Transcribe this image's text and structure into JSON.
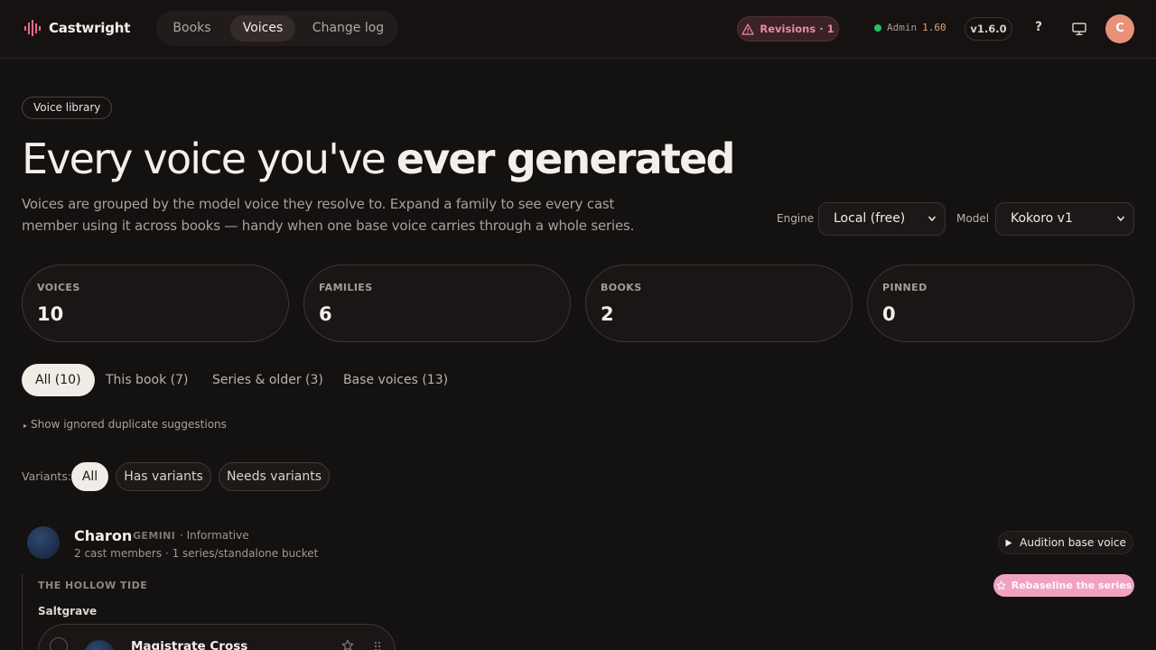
{
  "app": {
    "name": "Castwright",
    "nav": [
      "Books",
      "Voices",
      "Change log"
    ],
    "active_nav": "Voices",
    "revisions_label": "Revisions · 1",
    "admin_label": "Admin",
    "admin_value": "1.60",
    "version": "v1.6.0",
    "help": "?",
    "user_initial": "C"
  },
  "header": {
    "chip": "Voice library",
    "title_light": "Every voice you've ",
    "title_bold": "ever generated",
    "lede": "Voices are grouped by the model voice they resolve to. Expand a family to see every cast member using it across books — handy when one base voice carries through a whole series.",
    "engine_label": "Engine",
    "engine_value": "Local (free)",
    "model_label": "Model",
    "model_value": "Kokoro v1"
  },
  "stats": [
    {
      "label": "VOICES",
      "value": "10"
    },
    {
      "label": "FAMILIES",
      "value": "6"
    },
    {
      "label": "BOOKS",
      "value": "2"
    },
    {
      "label": "PINNED",
      "value": "0"
    }
  ],
  "filters": {
    "tabs": [
      "All (10)",
      "This book (7)",
      "Series & older (3)",
      "Base voices (13)"
    ],
    "ignored_toggle": "Show ignored duplicate suggestions",
    "variants_label": "Variants:",
    "variants": [
      "All",
      "Has variants",
      "Needs variants"
    ]
  },
  "family": {
    "name": "Charon",
    "engine": "GEMINI",
    "style": "· Informative",
    "meta": "2 cast members · 1 series/standalone bucket",
    "audition_label": "Audition base voice",
    "rebaseline_label": "Rebaseline the series",
    "series_title": "THE HOLLOW TIDE",
    "book": "Saltgrave",
    "cast": [
      {
        "name": "Magistrate Cross"
      }
    ]
  },
  "colors": {
    "background": "#141111",
    "accent_pink": "#f0a3c1",
    "status_green": "#22c55e",
    "avatar": "#e9917a"
  },
  "icons": [
    "waveform-icon",
    "warning-icon",
    "status-dot-icon",
    "help-icon",
    "monitor-icon",
    "chevron-down-icon",
    "play-icon",
    "star-icon",
    "grip-icon"
  ]
}
